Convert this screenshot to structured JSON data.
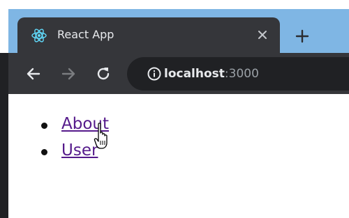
{
  "browser": {
    "tab": {
      "title": "React App",
      "favicon": "react-logo-icon",
      "close_icon": "close-icon"
    },
    "new_tab_icon": "plus-icon",
    "toolbar": {
      "back_icon": "arrow-left-icon",
      "forward_icon": "arrow-right-icon",
      "forward_enabled": false,
      "reload_icon": "reload-icon",
      "site_info_icon": "info-icon",
      "url_host": "localhost",
      "url_port": ":3000"
    },
    "colors": {
      "tabstrip": "#7fb6e4",
      "chrome_dark": "#35363a",
      "omnibox": "#202124",
      "react_logo": "#61dafb"
    }
  },
  "page": {
    "nav": [
      {
        "label": "About"
      },
      {
        "label": "User"
      }
    ],
    "link_color": "#551a8b",
    "cursor": "hand-pointer-icon"
  }
}
